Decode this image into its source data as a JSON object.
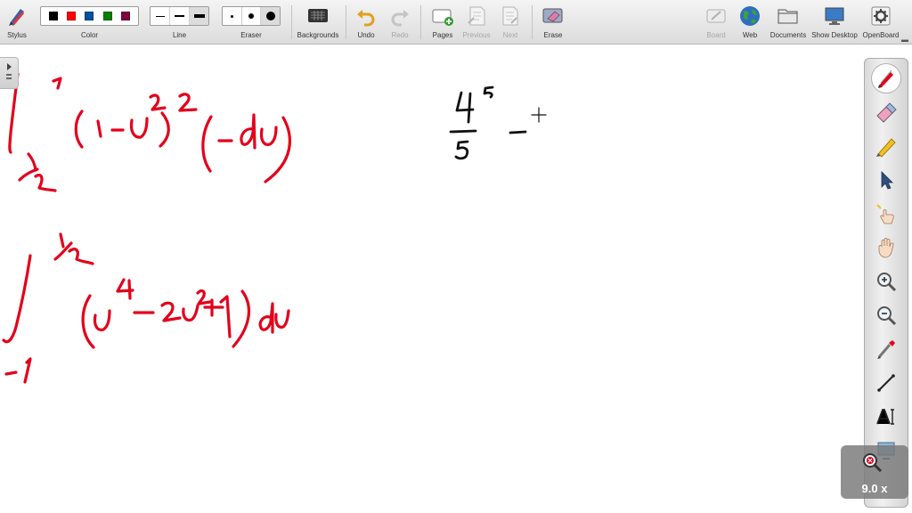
{
  "toolbar": {
    "stylus_label": "Stylus",
    "color_label": "Color",
    "line_label": "Line",
    "eraser_label": "Eraser",
    "backgrounds_label": "Backgrounds",
    "undo_label": "Undo",
    "redo_label": "Redo",
    "pages_label": "Pages",
    "previous_label": "Previous",
    "next_label": "Next",
    "erase_label": "Erase",
    "board_label": "Board",
    "web_label": "Web",
    "documents_label": "Documents",
    "show_desktop_label": "Show Desktop",
    "openboard_label": "OpenBoard",
    "colors": [
      "#000000",
      "#ff0000",
      "#0050a0",
      "#008000",
      "#800040"
    ],
    "selected_color": "#000000"
  },
  "zoom": {
    "value": "9.0 x"
  },
  "ink_colors": {
    "red": "#e3001b",
    "black": "#111111"
  },
  "palette_tools": [
    "pen-icon",
    "eraser-icon",
    "highlighter-icon",
    "pointer-icon",
    "laser-pointer-icon",
    "hand-icon",
    "zoom-in-icon",
    "zoom-out-icon",
    "capture-icon",
    "line-icon",
    "text-icon",
    "screen-capture-icon"
  ]
}
